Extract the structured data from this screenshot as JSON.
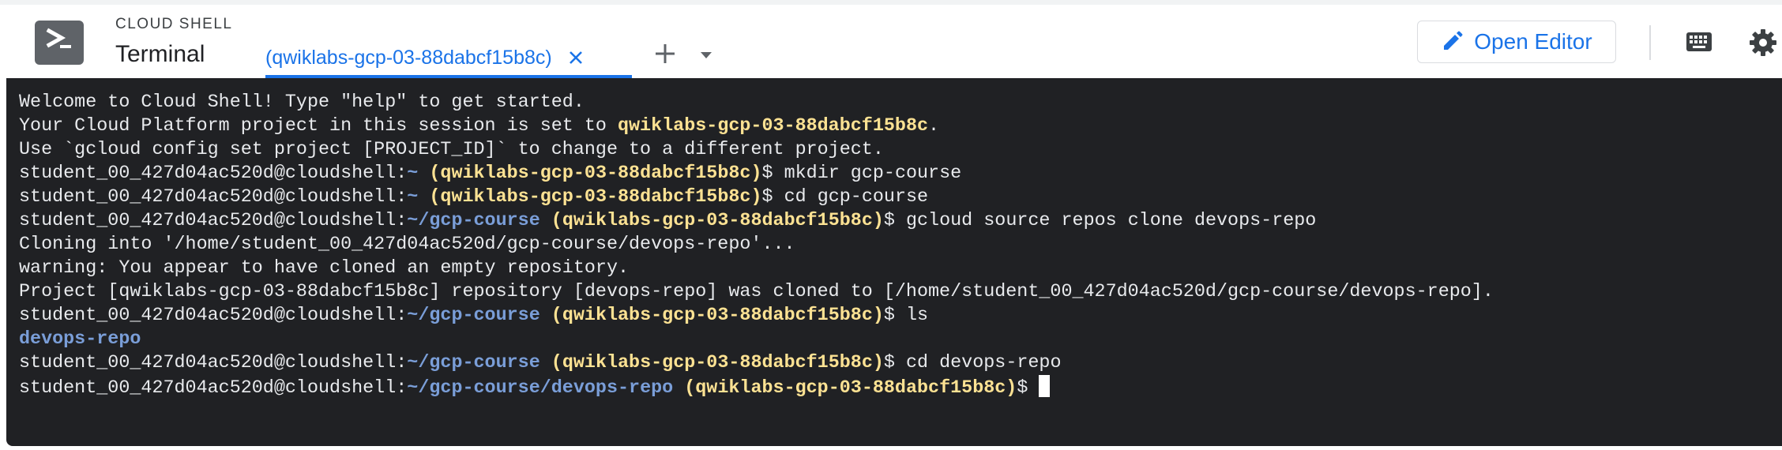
{
  "header": {
    "product": "CLOUD SHELL",
    "title": "Terminal",
    "tab_label": "(qwiklabs-gcp-03-88dabcf15b8c)",
    "open_editor_label": "Open Editor"
  },
  "icons": {
    "logo": "cloud-shell-logo-icon",
    "close": "close-icon",
    "add": "plus-icon",
    "menu": "chevron-down-icon",
    "editor": "pencil-icon",
    "keyboard": "keyboard-icon",
    "settings": "gear-icon"
  },
  "colors": {
    "accent": "#1a73e8",
    "terminal_bg": "#202124",
    "project": "#fde293",
    "path": "#8ab4f8"
  },
  "terminal": {
    "welcome": "Welcome to Cloud Shell! Type \"help\" to get started.",
    "project_msg_prefix": "Your Cloud Platform project in this session is set to ",
    "project_id": "qwiklabs-gcp-03-88dabcf15b8c",
    "project_msg_suffix": ".",
    "hint": "Use `gcloud config set project [PROJECT_ID]` to change to a different project.",
    "user_host": "student_00_427d04ac520d@cloudshell:",
    "project_prompt": "(qwiklabs-gcp-03-88dabcf15b8c)",
    "prompt_symbol": "$ ",
    "path_home": "~",
    "path_course": "~/gcp-course",
    "path_repo": "~/gcp-course/devops-repo",
    "cmd1": "mkdir gcp-course",
    "cmd2": "cd gcp-course",
    "cmd3": "gcloud source repos clone devops-repo",
    "out_cloning": "Cloning into '/home/student_00_427d04ac520d/gcp-course/devops-repo'...",
    "out_warning": "warning: You appear to have cloned an empty repository.",
    "out_project": "Project [qwiklabs-gcp-03-88dabcf15b8c] repository [devops-repo] was cloned to [/home/student_00_427d04ac520d/gcp-course/devops-repo].",
    "cmd4": "ls",
    "out_ls": "devops-repo",
    "cmd5": "cd devops-repo"
  }
}
